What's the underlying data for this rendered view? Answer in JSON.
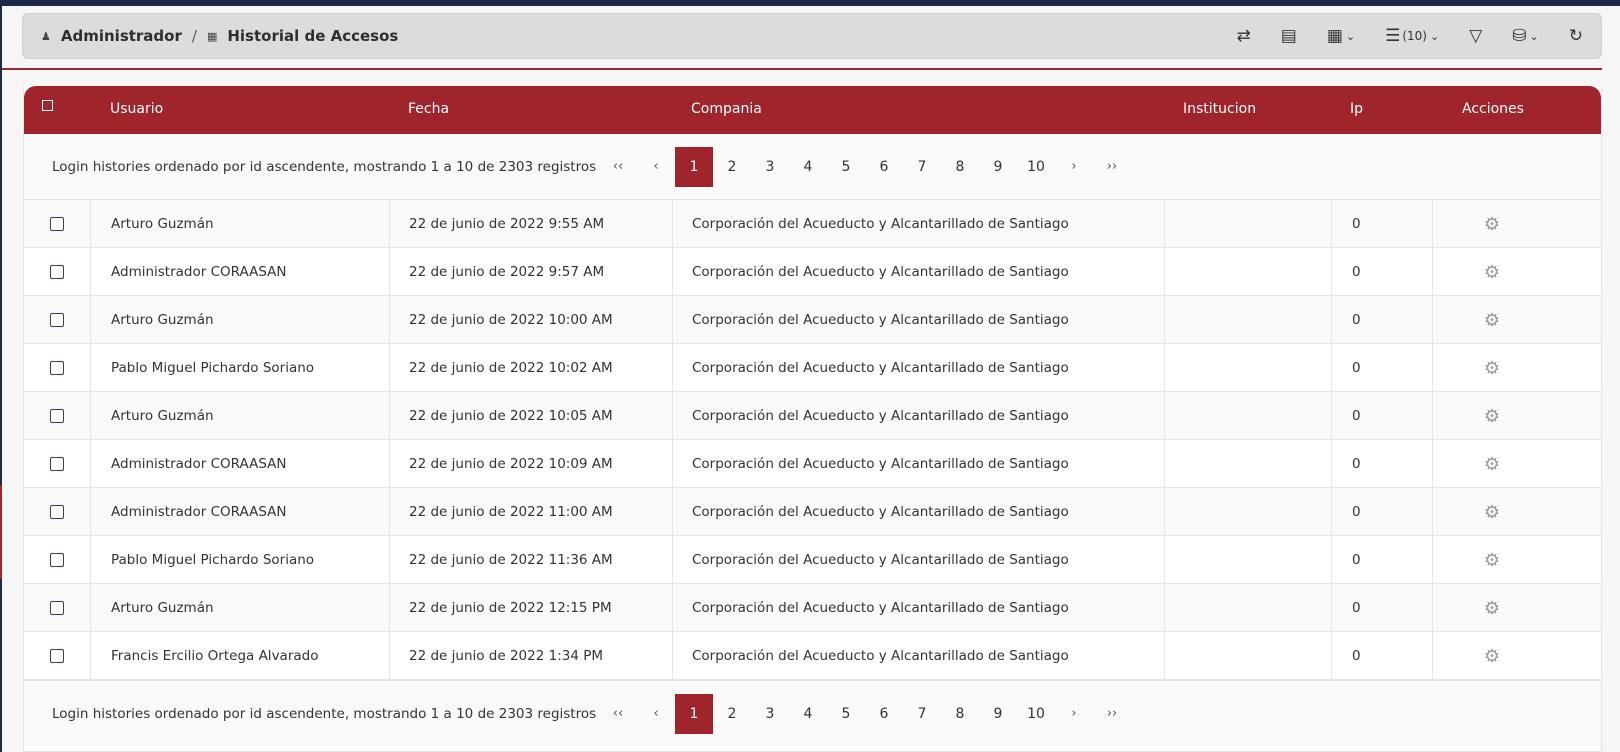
{
  "breadcrumb": {
    "root": "Administrador",
    "current": "Historial de Accesos"
  },
  "toolbar": {
    "page_size": "(10)"
  },
  "table": {
    "columns": [
      "Usuario",
      "Fecha",
      "Compania",
      "Institucion",
      "Ip",
      "Acciones"
    ],
    "summary": "Login histories ordenado por id ascendente, mostrando 1 a 10 de 2303 registros",
    "pages": [
      "1",
      "2",
      "3",
      "4",
      "5",
      "6",
      "7",
      "8",
      "9",
      "10"
    ],
    "current_page": "1",
    "pager_nav": {
      "first": "‹‹",
      "prev": "‹",
      "next": "›",
      "last": "››"
    },
    "rows": [
      {
        "usuario": "Arturo Guzmán",
        "fecha": "22 de junio de 2022 9:55 AM",
        "compania": "Corporación del Acueducto y Alcantarillado de Santiago",
        "institucion": "",
        "ip": "0"
      },
      {
        "usuario": "Administrador CORAASAN",
        "fecha": "22 de junio de 2022 9:57 AM",
        "compania": "Corporación del Acueducto y Alcantarillado de Santiago",
        "institucion": "",
        "ip": "0"
      },
      {
        "usuario": "Arturo Guzmán",
        "fecha": "22 de junio de 2022 10:00 AM",
        "compania": "Corporación del Acueducto y Alcantarillado de Santiago",
        "institucion": "",
        "ip": "0"
      },
      {
        "usuario": "Pablo Miguel Pichardo Soriano",
        "fecha": "22 de junio de 2022 10:02 AM",
        "compania": "Corporación del Acueducto y Alcantarillado de Santiago",
        "institucion": "",
        "ip": "0"
      },
      {
        "usuario": "Arturo Guzmán",
        "fecha": "22 de junio de 2022 10:05 AM",
        "compania": "Corporación del Acueducto y Alcantarillado de Santiago",
        "institucion": "",
        "ip": "0"
      },
      {
        "usuario": "Administrador CORAASAN",
        "fecha": "22 de junio de 2022 10:09 AM",
        "compania": "Corporación del Acueducto y Alcantarillado de Santiago",
        "institucion": "",
        "ip": "0"
      },
      {
        "usuario": "Administrador CORAASAN",
        "fecha": "22 de junio de 2022 11:00 AM",
        "compania": "Corporación del Acueducto y Alcantarillado de Santiago",
        "institucion": "",
        "ip": "0"
      },
      {
        "usuario": "Pablo Miguel Pichardo Soriano",
        "fecha": "22 de junio de 2022 11:36 AM",
        "compania": "Corporación del Acueducto y Alcantarillado de Santiago",
        "institucion": "",
        "ip": "0"
      },
      {
        "usuario": "Arturo Guzmán",
        "fecha": "22 de junio de 2022 12:15 PM",
        "compania": "Corporación del Acueducto y Alcantarillado de Santiago",
        "institucion": "",
        "ip": "0"
      },
      {
        "usuario": "Francis Ercilio Ortega Alvarado",
        "fecha": "22 de junio de 2022 1:34 PM",
        "compania": "Corporación del Acueducto y Alcantarillado de Santiago",
        "institucion": "",
        "ip": "0"
      }
    ]
  },
  "colors": {
    "accent": "#a0242c",
    "toolbar_bg": "#dcdcdc",
    "top_strip": "#1b2a4a"
  },
  "icons": {
    "breadcrumb_root": "user-icon",
    "breadcrumb_current": "book-icon",
    "row_action": "gear-icon",
    "tools": [
      "swap-icon",
      "columns-icon",
      "table-layout-icon",
      "list-icon",
      "filter-icon",
      "export-icon",
      "refresh-icon"
    ]
  }
}
